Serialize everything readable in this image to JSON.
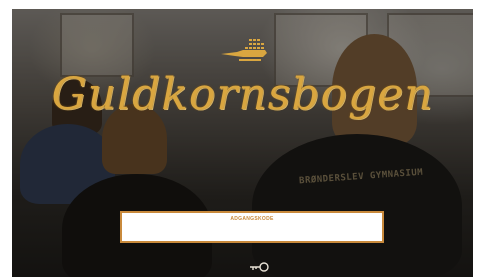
{
  "app": {
    "title": "Guldkornsbogen"
  },
  "login": {
    "field_label": "ADGANGSKODE",
    "field_value": "",
    "field_placeholder": ""
  },
  "background": {
    "shirt_text": "BRØNDERSLEV GYMNASIUM"
  },
  "icons": {
    "logo": "lamp-icon",
    "submit": "key-icon"
  },
  "colors": {
    "accent_gold": "#d9a640",
    "input_border": "#c98a3c"
  }
}
